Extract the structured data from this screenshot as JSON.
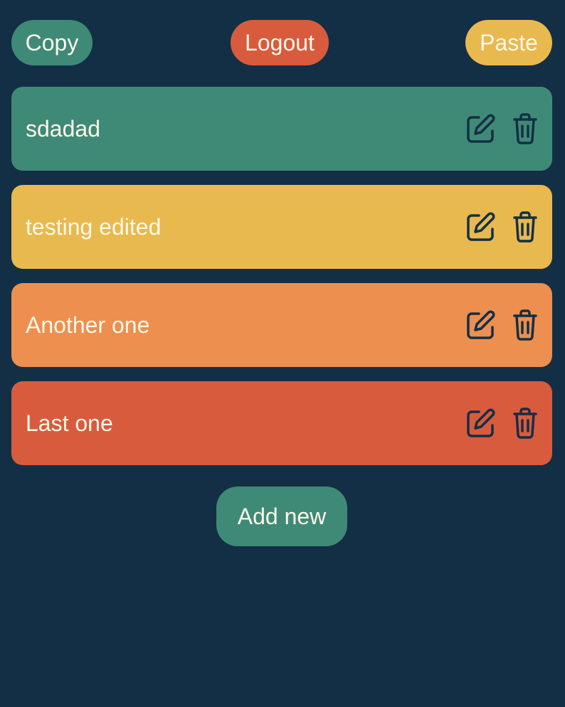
{
  "header": {
    "copy": {
      "label": "Copy",
      "color": "#3f8a76"
    },
    "logout": {
      "label": "Logout",
      "color": "#d95b3d"
    },
    "paste": {
      "label": "Paste",
      "color": "#e8b94f"
    }
  },
  "notes": [
    {
      "text": "sdadad",
      "color": "#3f8a76"
    },
    {
      "text": "testing edited",
      "color": "#e8b94f"
    },
    {
      "text": "Another one",
      "color": "#ec8f4f"
    },
    {
      "text": "Last one",
      "color": "#d95b3d"
    }
  ],
  "icons": {
    "edit": "edit-icon",
    "delete": "trash-icon",
    "icon_color": "#132f45"
  },
  "add_button": {
    "label": "Add new",
    "color": "#3f8a76"
  },
  "theme": {
    "background": "#132f45",
    "text": "#fdf8ea"
  }
}
